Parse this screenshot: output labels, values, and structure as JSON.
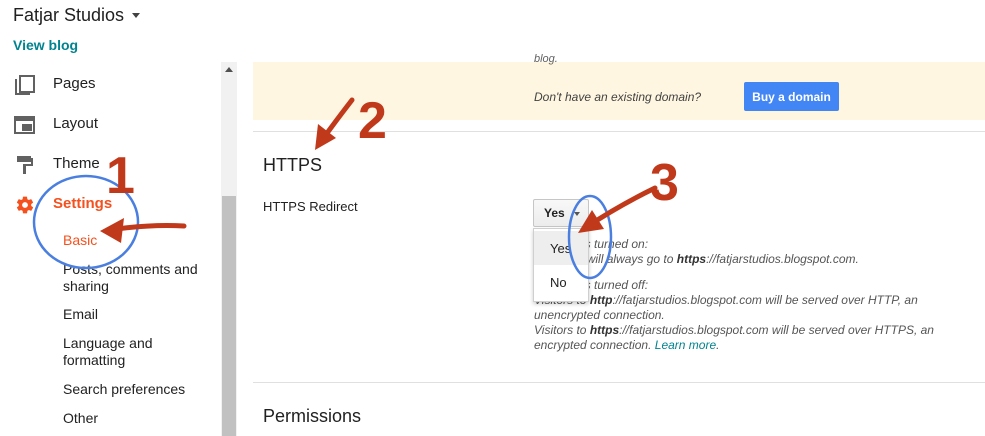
{
  "header": {
    "blog_title": "Fatjar Studios",
    "view_blog": "View blog"
  },
  "sidebar": {
    "items": [
      {
        "label": "Pages",
        "icon": "pages-icon"
      },
      {
        "label": "Layout",
        "icon": "layout-icon"
      },
      {
        "label": "Theme",
        "icon": "theme-icon"
      },
      {
        "label": "Settings",
        "icon": "gear-icon"
      }
    ],
    "subitems": [
      "Basic",
      "Posts, comments and sharing",
      "Email",
      "Language and formatting",
      "Search preferences",
      "Other"
    ],
    "active_color": "#f4511e"
  },
  "domain": {
    "tail_text": "blog.",
    "question": "Don't have an existing domain?",
    "buy_button": "Buy a domain"
  },
  "https": {
    "title": "HTTPS",
    "redirect_label": "HTTPS Redirect",
    "selected": "Yes",
    "options": [
      "Yes",
      "No"
    ],
    "desc_on_1": "Redirect is turned on:",
    "desc_on_2": "your blog will always go to",
    "url_https": "https",
    "url_domain": "://fatjarstudios.blogspot.com.",
    "desc_off_1": "Redirect is turned off:",
    "desc_off_2a": "Visitors to",
    "url_http": "http",
    "url_domain_plain": "://fatjarstudios.blogspot.com",
    "desc_off_2b": "will be served over HTTP, an",
    "desc_off_3": "unencrypted connection.",
    "desc_off_4a": "Visitors to",
    "desc_off_4b": "will be served over HTTPS, an",
    "desc_off_5": "encrypted connection.",
    "learn_more": "Learn more",
    "period": "."
  },
  "permissions": {
    "title": "Permissions"
  },
  "annotations": {
    "num1": "1",
    "num2": "2",
    "num3": "3",
    "color_arrow": "#c0391b",
    "color_circle": "#4a7fe0"
  }
}
